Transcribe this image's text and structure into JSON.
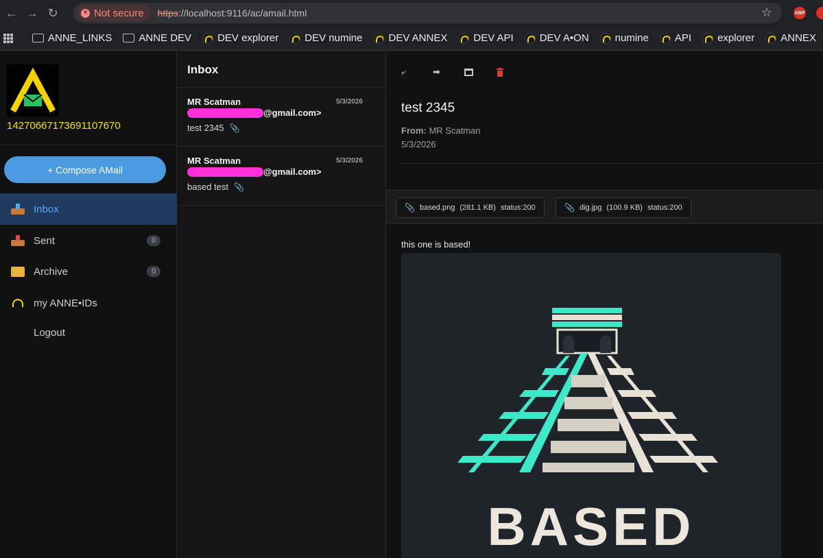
{
  "browser": {
    "security_label": "Not secure",
    "url_scheme": "https",
    "url_rest": "://localhost:9116/ac/amail.html",
    "extension_abp": "ABP",
    "bookmarks": [
      {
        "label": "ANNE_LINKS",
        "icon": "folder-icon"
      },
      {
        "label": "ANNE DEV",
        "icon": "folder-icon"
      },
      {
        "label": "DEV explorer",
        "icon": "anne-icon"
      },
      {
        "label": "DEV numine",
        "icon": "anne-icon"
      },
      {
        "label": "DEV ANNEX",
        "icon": "anne-icon"
      },
      {
        "label": "DEV API",
        "icon": "anne-icon"
      },
      {
        "label": "DEV A•ON",
        "icon": "anne-icon"
      },
      {
        "label": "numine",
        "icon": "anne-icon"
      },
      {
        "label": "API",
        "icon": "anne-icon"
      },
      {
        "label": "explorer",
        "icon": "anne-icon"
      },
      {
        "label": "ANNEX",
        "icon": "anne-icon"
      }
    ]
  },
  "sidebar": {
    "user_id": "14270667173691107670",
    "compose_label": "+ Compose AMail",
    "items": [
      {
        "label": "Inbox",
        "icon": "inbox-icon",
        "badge": ""
      },
      {
        "label": "Sent",
        "icon": "sent-icon",
        "badge": "0"
      },
      {
        "label": "Archive",
        "icon": "folder-icon",
        "badge": "0"
      },
      {
        "label": "my ANNE•IDs",
        "icon": "anne-icon",
        "badge": ""
      },
      {
        "label": "Logout",
        "icon": "",
        "badge": ""
      }
    ]
  },
  "list": {
    "title": "Inbox",
    "items": [
      {
        "from": "MR Scatman",
        "email_suffix": "@gmail.com>",
        "date": "5/3/2026",
        "subject": "test 2345"
      },
      {
        "from": "MR Scatman",
        "email_suffix": "@gmail.com>",
        "date": "5/3/2026",
        "subject": "based test"
      }
    ]
  },
  "message": {
    "subject": "test 2345",
    "from_label": "From:",
    "from_value": "MR Scatman",
    "date": "5/3/2026",
    "attachments": [
      {
        "name": "based.png",
        "size": "(281.1 KB)",
        "status": "status:200"
      },
      {
        "name": "dig.jpg",
        "size": "(100.9 KB)",
        "status": "status:200"
      }
    ],
    "body": "this one is based!",
    "image_caption": "BASED"
  },
  "colors": {
    "accent": "#4a9be0",
    "active_bg": "#1e3a5f",
    "user_id": "#f5e000",
    "trash": "#e53935",
    "pyramid_teal": "#3de8c8"
  }
}
